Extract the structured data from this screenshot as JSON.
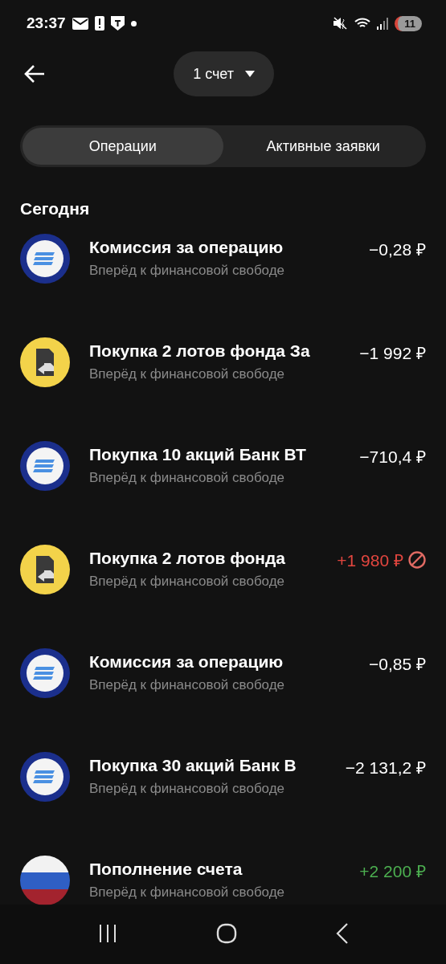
{
  "status_bar": {
    "time": "23:37",
    "battery": "11"
  },
  "header": {
    "account": "1 счет"
  },
  "tabs": [
    {
      "label": "Операции",
      "selected": true
    },
    {
      "label": "Активные заявки",
      "selected": false
    }
  ],
  "section": "Сегодня",
  "operations": [
    {
      "kind": "stripes",
      "title": "Комиссия за операцию",
      "subtitle": "Вперёд к финансовой свободе",
      "amount": "−0,28 ₽",
      "color": "#ffffff",
      "cancelled": false
    },
    {
      "kind": "document",
      "title": "Покупка 2 лотов фонда За",
      "subtitle": "Вперёд к финансовой свободе",
      "amount": "−1 992 ₽",
      "color": "#ffffff",
      "cancelled": false
    },
    {
      "kind": "stripes",
      "title": "Покупка 10 акций Банк ВТ",
      "subtitle": "Вперёд к финансовой свободе",
      "amount": "−710,4 ₽",
      "color": "#ffffff",
      "cancelled": false
    },
    {
      "kind": "document",
      "title": "Покупка 2 лотов фонда",
      "subtitle": "Вперёд к финансовой свободе",
      "amount": "+1 980 ₽",
      "color": "#e2463f",
      "cancelled": true
    },
    {
      "kind": "stripes",
      "title": "Комиссия за операцию",
      "subtitle": "Вперёд к финансовой свободе",
      "amount": "−0,85 ₽",
      "color": "#ffffff",
      "cancelled": false
    },
    {
      "kind": "stripes",
      "title": "Покупка 30 акций Банк В",
      "subtitle": "Вперёд к финансовой свободе",
      "amount": "−2 131,2 ₽",
      "color": "#ffffff",
      "cancelled": false
    },
    {
      "kind": "flag",
      "title": "Пополнение счета",
      "subtitle": "Вперёд к финансовой свободе",
      "amount": "+2 200 ₽",
      "color": "#4caf50",
      "cancelled": false
    }
  ]
}
